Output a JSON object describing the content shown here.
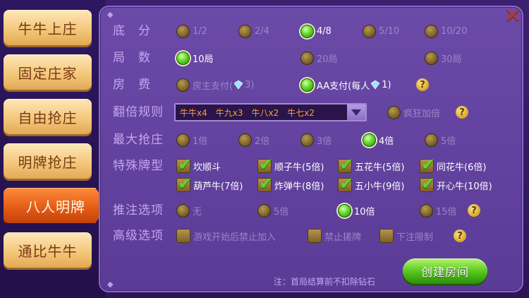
{
  "sidebar": {
    "items": [
      {
        "label": "牛牛上庄",
        "active": false
      },
      {
        "label": "固定庄家",
        "active": false
      },
      {
        "label": "自由抢庄",
        "active": false
      },
      {
        "label": "明牌抢庄",
        "active": false
      },
      {
        "label": "八人明牌",
        "active": true
      },
      {
        "label": "通比牛牛",
        "active": false
      }
    ]
  },
  "settings": {
    "base_score": {
      "label": "底　分",
      "options": [
        "1/2",
        "2/4",
        "4/8",
        "5/10",
        "10/20"
      ],
      "selected": "4/8"
    },
    "rounds": {
      "label": "局　数",
      "options": [
        "10局",
        "20局",
        "30局"
      ],
      "selected": "10局"
    },
    "room_fee": {
      "label": "房　费",
      "owner_option": {
        "text": "房主支付(",
        "amount": "3)"
      },
      "aa_option": {
        "text": "AA支付(每人",
        "amount": "1)"
      },
      "selected": "AA支付(每人 1)"
    },
    "multiplier_rule": {
      "label": "翻倍规则",
      "dropdown_value": "牛牛x4　牛九x3　牛八x2　牛七x2",
      "crazy_option": "疯狂加倍"
    },
    "max_grab": {
      "label": "最大抢庄",
      "options": [
        "1倍",
        "2倍",
        "3倍",
        "4倍",
        "5倍"
      ],
      "selected": "4倍"
    },
    "special_hands": {
      "label": "特殊牌型",
      "options": [
        "坎顺斗",
        "顺子牛(5倍)",
        "五花牛(5倍)",
        "同花牛(6倍)",
        "葫芦牛(7倍)",
        "炸弹牛(8倍)",
        "五小牛(9倍)",
        "开心牛(10倍)"
      ]
    },
    "push_bet": {
      "label": "推注选项",
      "options": [
        "无",
        "5倍",
        "10倍",
        "15倍"
      ],
      "selected": "10倍"
    },
    "advanced": {
      "label": "高级选项",
      "options": [
        "游戏开始后禁止加入",
        "禁止搓牌",
        "下注限制"
      ]
    }
  },
  "footer": {
    "note": "注：首局结算前不扣除钻石",
    "create_button": "创建房间"
  },
  "colors": {
    "selected_radio": "#5fd62a",
    "accent_orange": "#f3a243",
    "close_red": "#b8392d"
  },
  "icons": {
    "close": "close-icon",
    "help": "help-icon",
    "diamond": "diamond-icon",
    "dropdown": "chevron-down-icon"
  }
}
